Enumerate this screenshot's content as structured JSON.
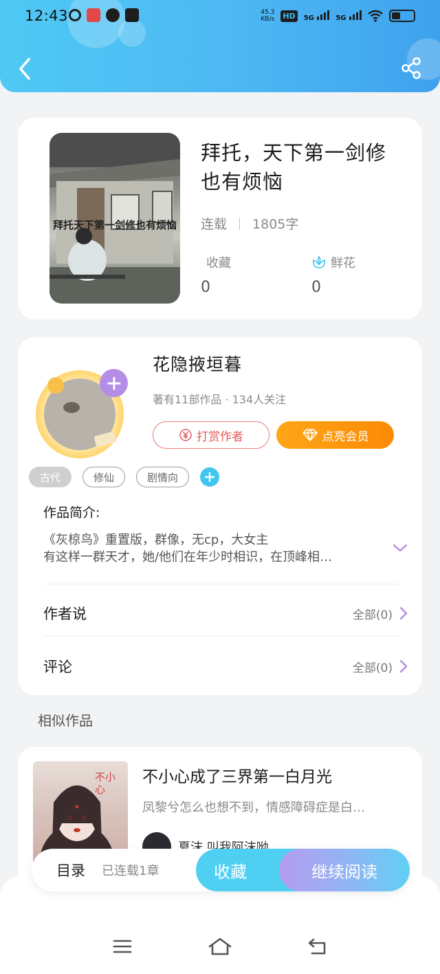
{
  "status_bar": {
    "time": "12:43",
    "speed_value": "45.3",
    "speed_unit": "KB/s",
    "hd_label": "HD",
    "sim1_label": "5G",
    "sim2_label": "5G"
  },
  "header": {
    "back_icon": "chevron-left-icon",
    "share_icon": "share-icon"
  },
  "book": {
    "title": "拜托，天下第一剑修也有烦恼",
    "status": "连载",
    "word_count": "1805字",
    "collect_label": "收藏",
    "collect_value": "0",
    "flower_label": "鲜花",
    "flower_value": "0",
    "cover_text": "拜托天下第一剑修也有烦恼"
  },
  "author": {
    "name": "花隐掖垣暮",
    "meta": "著有11部作品 · 134人关注",
    "tip_button": "打赏作者",
    "vip_button": "点亮会员",
    "tags": [
      "古代",
      "修仙",
      "剧情向"
    ],
    "intro_label": "作品简介:",
    "intro_lines": [
      "《灰椋鸟》重置版，群像，无cp，大女主",
      "有这样一群天才，她/他们在年少时相识，在顶峰相…"
    ],
    "author_says_label": "作者说",
    "author_says_right": "全部(0)",
    "comments_label": "评论",
    "comments_right": "全部(0)"
  },
  "similar": {
    "section_title": "相似作品",
    "items": [
      {
        "title": "不小心成了三界第一白月光",
        "desc": "凤黎兮怎么也想不到，情感障碍症是白…",
        "author": "夏沫 叫我阿沫呦",
        "cover_text": "不小心"
      }
    ]
  },
  "bottom_bar": {
    "toc_label": "目录",
    "toc_meta": "已连载1章",
    "favorite_button": "收藏",
    "read_button": "继续阅读"
  },
  "colors": {
    "accent_blue": "#4fc9f4",
    "vip_orange": "#fb8a07",
    "tip_red": "#e45a5a",
    "chevron_purple": "#b38ee0"
  }
}
